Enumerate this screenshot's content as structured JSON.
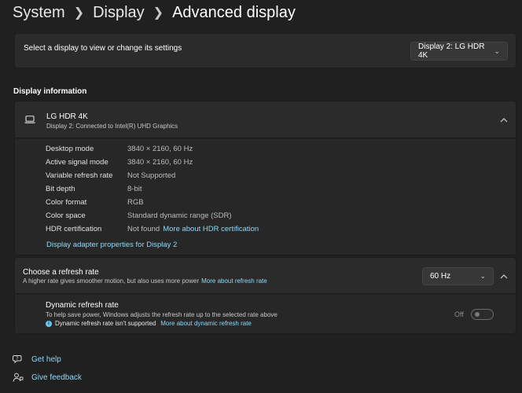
{
  "breadcrumb": [
    "System",
    "Display",
    "Advanced display"
  ],
  "display_select": {
    "label": "Select a display to view or change its settings",
    "selected": "Display 2: LG HDR 4K"
  },
  "section_title": "Display information",
  "display_info": {
    "name": "LG HDR 4K",
    "connection": "Display 2: Connected to Intel(R) UHD Graphics",
    "rows": [
      {
        "key": "Desktop mode",
        "value": "3840 × 2160, 60 Hz"
      },
      {
        "key": "Active signal mode",
        "value": "3840 × 2160, 60 Hz"
      },
      {
        "key": "Variable refresh rate",
        "value": "Not Supported"
      },
      {
        "key": "Bit depth",
        "value": "8-bit"
      },
      {
        "key": "Color format",
        "value": "RGB"
      },
      {
        "key": "Color space",
        "value": "Standard dynamic range (SDR)"
      },
      {
        "key": "HDR certification",
        "value": "Not found",
        "link": "More about HDR certification"
      }
    ],
    "adapter_link": "Display adapter properties for Display 2"
  },
  "refresh": {
    "title": "Choose a refresh rate",
    "subtitle": "A higher rate gives smoother motion, but also uses more power",
    "link": "More about refresh rate",
    "selected_rate": "60 Hz",
    "dynamic": {
      "title": "Dynamic refresh rate",
      "subtitle": "To help save power, Windows adjusts the refresh rate up to the selected rate above",
      "note": "Dynamic refresh rate isn't supported",
      "note_link": "More about dynamic refresh rate",
      "toggle_state": "Off"
    }
  },
  "footer": {
    "help": "Get help",
    "feedback": "Give feedback"
  },
  "colors": {
    "background": "#202020",
    "card": "#2b2b2b",
    "link": "#8ed8f8"
  },
  "icons": [
    "chevron-right-icon",
    "chevron-down-icon",
    "chevron-up-icon",
    "laptop-icon",
    "info-icon",
    "help-icon",
    "feedback-icon"
  ]
}
